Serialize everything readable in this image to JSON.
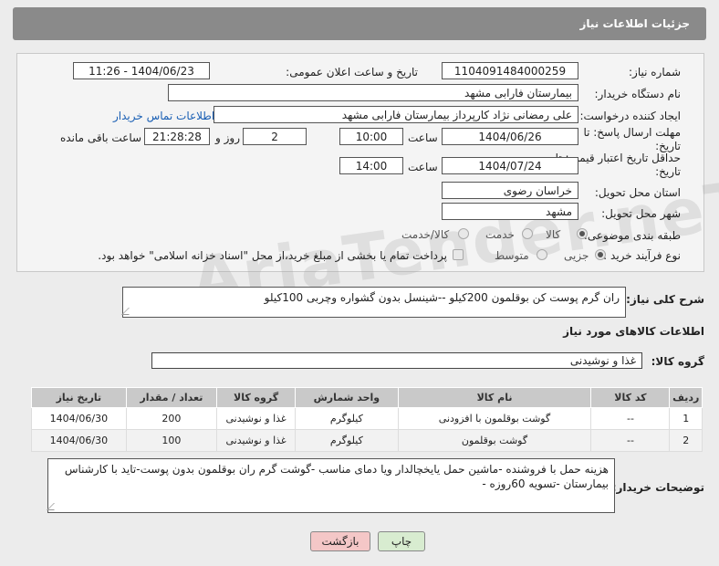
{
  "header": {
    "title": "جزئیات اطلاعات نیاز"
  },
  "form": {
    "need_number_label": "شماره نیاز:",
    "need_number": "1104091484000259",
    "announce_label": "تاریخ و ساعت اعلان عمومی:",
    "announce_value": "1404/06/23 - 11:26",
    "buyer_org_label": "نام دستگاه خریدار:",
    "buyer_org": "بیمارستان فارابی مشهد",
    "creator_label": "ایجاد کننده درخواست:",
    "creator": "علی رمضانی نژاد کارپرداز بیمارستان فارابی مشهد",
    "contact_link": "اطلاعات تماس خریدار",
    "reply_deadline_label": "مهلت ارسال پاسخ: تا تاریخ:",
    "reply_date": "1404/06/26",
    "time_label": "ساعت",
    "reply_time": "10:00",
    "days_value": "2",
    "days_and_label": "روز و",
    "remaining_time": "21:28:28",
    "remaining_label": "ساعت باقی مانده",
    "price_validity_label": "حداقل تاریخ اعتبار قیمت: تا تاریخ:",
    "price_date": "1404/07/24",
    "price_time": "14:00",
    "province_label": "استان محل تحویل:",
    "province": "خراسان رضوی",
    "city_label": "شهر محل تحویل:",
    "city": "مشهد",
    "category_label": "طبقه بندی موضوعی:",
    "category_options": [
      "کالا",
      "خدمت",
      "کالا/خدمت"
    ],
    "category_selected": "کالا",
    "process_label": "نوع فرآیند خرید :",
    "process_options": [
      "جزیی",
      "متوسط"
    ],
    "process_selected": "جزیی",
    "payment_note": "پرداخت تمام یا بخشی از مبلغ خرید،از محل \"اسناد خزانه اسلامی\" خواهد بود."
  },
  "description": {
    "label": "شرح کلی نیاز:",
    "text": "ران گرم پوست کن بوقلمون 200کیلو --شینسل بدون گشواره وچربی 100کیلو"
  },
  "items_section": {
    "title": "اطلاعات کالاهای مورد نیاز",
    "group_label": "گروه کالا:",
    "group_value": "غذا و نوشیدنی",
    "columns": [
      "ردیف",
      "کد کالا",
      "نام کالا",
      "واحد شمارش",
      "گروه کالا",
      "تعداد / مقدار",
      "تاریخ نیاز"
    ],
    "rows": [
      {
        "row": "1",
        "code": "--",
        "name": "گوشت بوقلمون با افزودنی",
        "unit": "کیلوگرم",
        "group": "غذا و نوشیدنی",
        "qty": "200",
        "date": "1404/06/30"
      },
      {
        "row": "2",
        "code": "--",
        "name": "گوشت بوقلمون",
        "unit": "کیلوگرم",
        "group": "غذا و نوشیدنی",
        "qty": "100",
        "date": "1404/06/30"
      }
    ]
  },
  "buyer_notes": {
    "label": "توضیحات خریدار:",
    "text": "هزینه حمل با فروشنده -ماشین حمل یایخچالدار ویا دمای مناسب -گوشت گرم ران بوقلمون بدون پوست-تاید با کارشناس بیمارستان -تسویه 60روزه -"
  },
  "buttons": {
    "print": "چاپ",
    "back": "بازگشت"
  },
  "watermark": "AriaTender.neT",
  "colors": {
    "header_bg": "#8a8a8a",
    "link": "#1a5fb4",
    "back_btn": "#f4c7c7",
    "print_btn": "#d8ecd0"
  }
}
